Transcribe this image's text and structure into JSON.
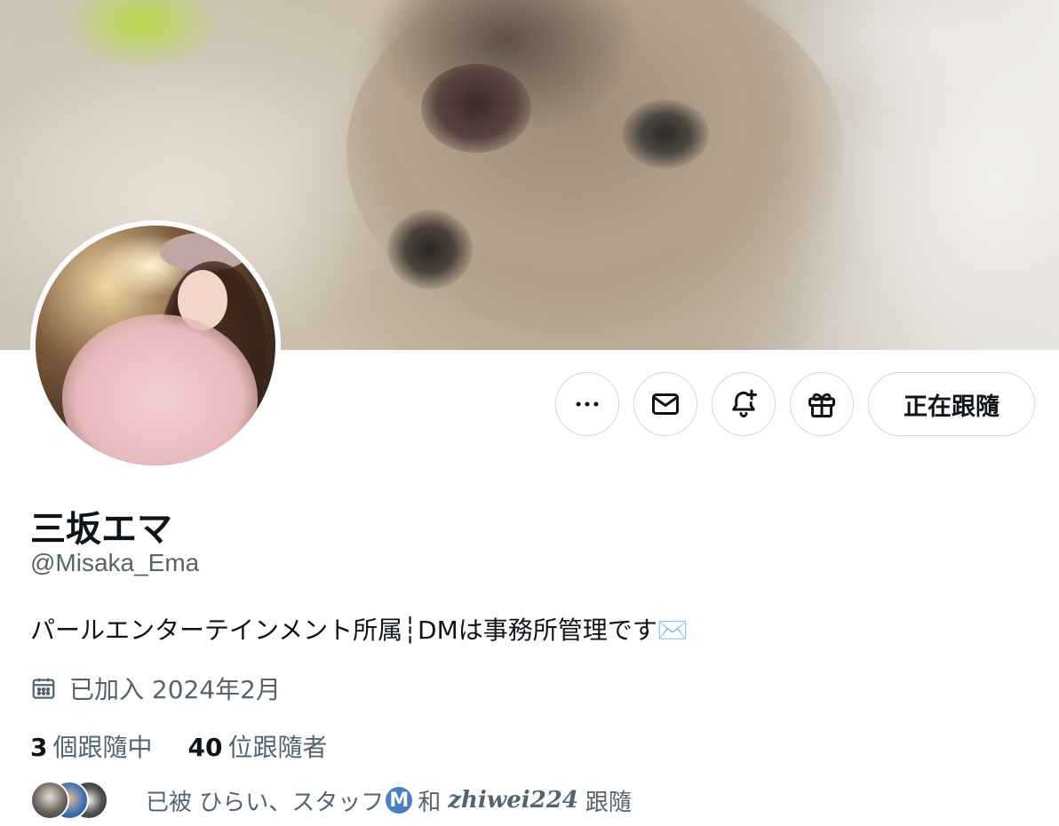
{
  "profile": {
    "display_name": "三坂エマ",
    "handle": "@Misaka_Ema",
    "bio": "パールエンターテインメント所属┆DMは事務所管理です✉️",
    "joined": "已加入 2024年2月"
  },
  "actions": {
    "more_icon": "more-horizontal-icon",
    "message_icon": "envelope-icon",
    "notify_icon": "bell-plus-icon",
    "gift_icon": "gift-icon",
    "follow_label": "正在跟隨"
  },
  "stats": {
    "following_count": "3",
    "following_label": "個跟隨中",
    "followers_count": "40",
    "followers_label": "位跟隨者"
  },
  "followed_by": {
    "prefix": "已被 ひらい、スタッフ",
    "badge": "M",
    "and": "和",
    "user": "𝒛𝒉𝒊𝒘𝒆𝒊224",
    "suffix": "跟隨"
  },
  "colors": {
    "text_primary": "#0f1419",
    "text_secondary": "#536471",
    "border": "#cfd9de",
    "badge_blue": "#4a7ec0"
  }
}
